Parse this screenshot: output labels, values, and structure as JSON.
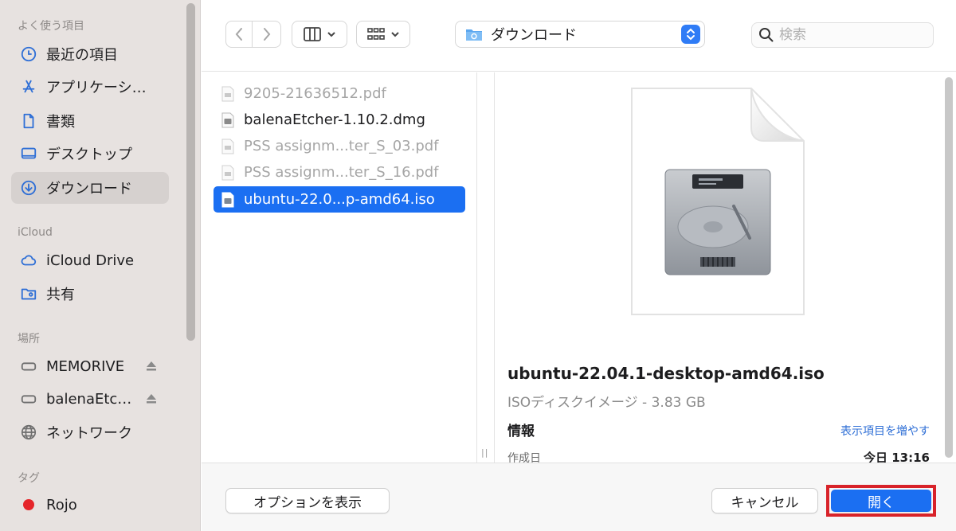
{
  "sidebar": {
    "sections": [
      {
        "heading": "よく使う項目",
        "items": [
          {
            "label": "最近の項目",
            "icon": "clock-icon"
          },
          {
            "label": "アプリケーシ…",
            "icon": "applications-icon"
          },
          {
            "label": "書類",
            "icon": "document-icon"
          },
          {
            "label": "デスクトップ",
            "icon": "desktop-icon"
          },
          {
            "label": "ダウンロード",
            "icon": "download-icon",
            "selected": true
          }
        ]
      },
      {
        "heading": "iCloud",
        "items": [
          {
            "label": "iCloud Drive",
            "icon": "cloud-icon"
          },
          {
            "label": "共有",
            "icon": "shared-folder-icon"
          }
        ]
      },
      {
        "heading": "場所",
        "items": [
          {
            "label": "MEMORIVE",
            "icon": "drive-icon",
            "eject": true
          },
          {
            "label": "balenaEtc…",
            "icon": "drive-icon",
            "eject": true
          },
          {
            "label": "ネットワーク",
            "icon": "network-icon"
          }
        ]
      },
      {
        "heading": "タグ",
        "items": [
          {
            "label": "Rojo",
            "icon": "tag-dot-icon",
            "color": "#e5252a"
          }
        ]
      }
    ]
  },
  "toolbar": {
    "location": "ダウンロード",
    "search_placeholder": "検索"
  },
  "files": [
    {
      "name": "9205-21636512.pdf",
      "state": "dim"
    },
    {
      "name": "balenaEtcher-1.10.2.dmg",
      "state": "normal"
    },
    {
      "name": "PSS assignm...ter_S_03.pdf",
      "state": "dim"
    },
    {
      "name": "PSS assignm...ter_S_16.pdf",
      "state": "dim"
    },
    {
      "name": "ubuntu-22.0...p-amd64.iso",
      "state": "selected"
    }
  ],
  "preview": {
    "filename": "ubuntu-22.04.1-desktop-amd64.iso",
    "kind": "ISOディスクイメージ - 3.83 GB",
    "info_heading": "情報",
    "show_more": "表示項目を増やす",
    "created_label": "作成日",
    "created_value": "今日 13:16"
  },
  "buttons": {
    "options": "オプションを表示",
    "cancel": "キャンセル",
    "open": "開く"
  },
  "colors": {
    "accent": "#1b6ff2",
    "highlight_border": "#d8232a"
  }
}
